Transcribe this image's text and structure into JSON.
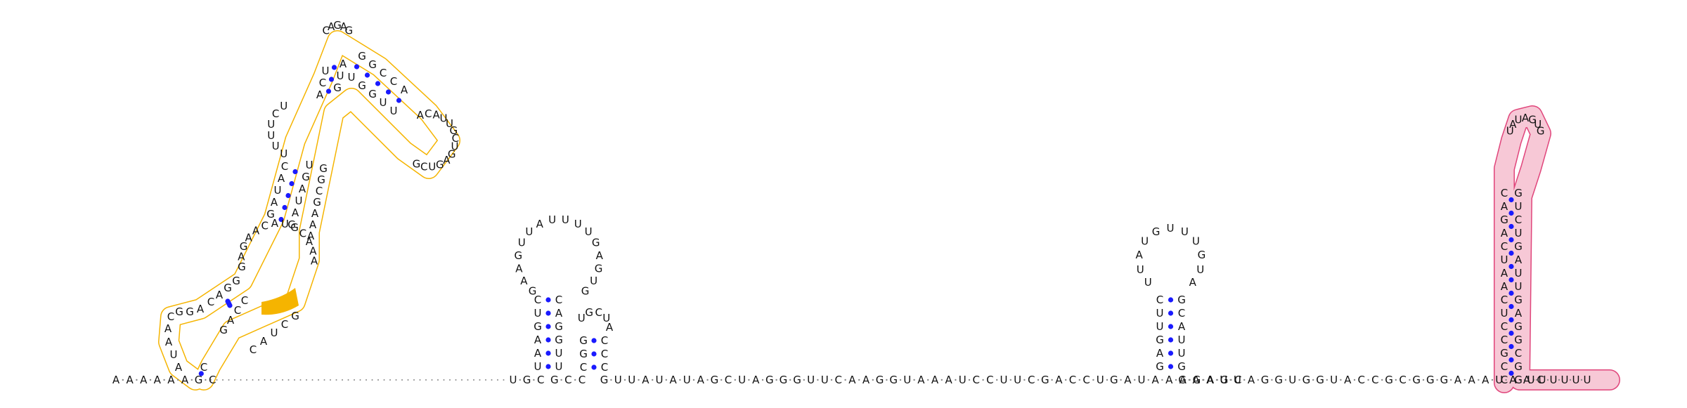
{
  "colors": {
    "nucleotide": "#111111",
    "backbone": "#888888",
    "base_pair_dot": "#1a1aff",
    "highlight_orange": "#f5b400",
    "highlight_orange_fill": "#f5b400",
    "highlight_pink": "#e0457b",
    "highlight_pink_fill": "#f7c8d6",
    "background": "#ffffff"
  },
  "segments": {
    "five_prime_tail": "AAAAAAGC",
    "hairpin1_stem5": "UGC",
    "hairpin1_stemA": "UAAGUC",
    "hairpin1_loop": "GAAGUUAUUUUGAGUG",
    "hairpin1_stemB": "CAGGUU",
    "hairpin2_stem5": "GCC",
    "hairpin2_loop": "UGCUA",
    "hairpin2_stem3": "CCC",
    "linker": "GUUAUAUAGCUAGGGUUCAAGGUAAAUCCUUCGACCUGAUAAAGAGC",
    "hairpin3_stemA": "GAGUUC",
    "hairpin3_loop": "UUAUGUUUGUA",
    "hairpin3_stemB": "GCAUUG",
    "spacer": "GAAUUAGGUGGUACCGCGGGAAAUAAC",
    "terminator_stem5": "CCGCCUCAAUCAGAC",
    "terminator_loop": "UAUAGUG",
    "terminator_stem3": "GUCUGAUUGAGGCGG",
    "three_prime_tail": "UUUUUU",
    "leftdomain_stem5": "CGACUAACAAGACG",
    "leftdomain_loop": "AGAUUCUUCUUAUCAGAGAGCCAACAUUUGAGUCGAGUUUGGAAAUGAUAUUGCAAAUGCUAGAAG",
    "leftdomain_stem3": "CAUCCGC"
  },
  "legend": []
}
